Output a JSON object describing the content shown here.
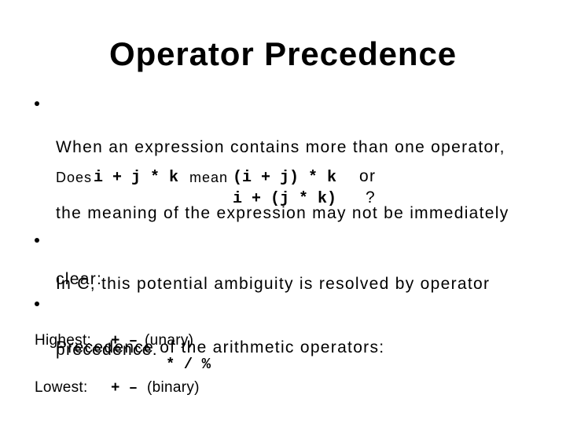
{
  "slide": {
    "title": "Operator Precedence",
    "bullets": [
      {
        "lines": [
          "When an expression contains more than one operator,",
          "the meaning of the expression may not be immediately",
          "clear:"
        ]
      },
      {
        "lines": [
          "In C, this potential ambiguity is resolved by operator",
          "precedence."
        ]
      },
      {
        "lines": [
          "Precedence of the arithmetic operators:"
        ]
      }
    ],
    "example": {
      "prefix": "Does",
      "expression": "i + j * k",
      "mean_word": "mean",
      "option_a": "(i + j) * k",
      "or_word": "or",
      "option_b": "i + (j * k)",
      "question_mark": "?"
    },
    "precedence_table": {
      "rows": [
        {
          "level": "Highest:",
          "operators": "+ –",
          "note": "(unary)"
        },
        {
          "level": "",
          "operators": "* / %",
          "note": ""
        },
        {
          "level": "Lowest:",
          "operators": "+ –",
          "note": "(binary)"
        }
      ]
    }
  },
  "icons": {
    "bullet": "bullet-dot"
  }
}
